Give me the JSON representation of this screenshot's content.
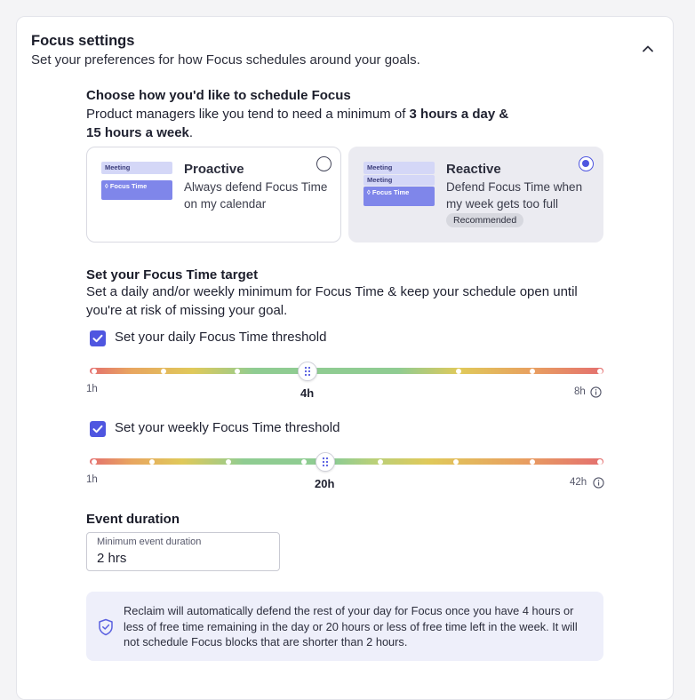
{
  "header": {
    "title": "Focus settings",
    "subtitle": "Set your preferences for how Focus schedules around your goals."
  },
  "schedule": {
    "title": "Choose how you'd like to schedule Focus",
    "body_prefix": "Product managers like you tend to need a minimum of ",
    "body_bold1": "3 hours a day &",
    "body_bold2": "15 hours a week",
    "body_suffix": ".",
    "options": [
      {
        "name": "Proactive",
        "description": "Always defend Focus Time on my calendar",
        "thumb_meeting": "Meeting",
        "thumb_focus": "Focus Time",
        "selected": false
      },
      {
        "name": "Reactive",
        "description": "Defend Focus Time when my week gets too full",
        "badge": "Recommended",
        "thumb_meeting": "Meeting",
        "thumb_meeting2": "Meeting",
        "thumb_focus": "Focus Time",
        "selected": true
      }
    ]
  },
  "target": {
    "title": "Set your Focus Time target",
    "body": "Set a daily and/or weekly minimum for Focus Time & keep your schedule open until you're at risk of missing your goal."
  },
  "daily": {
    "label": "Set your daily Focus Time threshold",
    "checked": true,
    "min_label": "1h",
    "max_label": "8h",
    "value_label": "4h",
    "min": 1,
    "max": 8,
    "value": 4
  },
  "weekly": {
    "label": "Set your weekly Focus Time threshold",
    "checked": true,
    "min_label": "1h",
    "max_label": "42h",
    "value_label": "20h",
    "min": 1,
    "max": 42,
    "value": 20
  },
  "duration": {
    "title": "Event duration",
    "field_label": "Minimum event duration",
    "field_value": "2 hrs"
  },
  "note": {
    "text": "Reclaim will automatically defend the rest of your day for Focus once you have 4 hours or less of free time remaining in the day or 20 hours or less of free time left in the week. It will not schedule Focus blocks that are shorter than 2 hours."
  },
  "colors": {
    "accent": "#4f56e0",
    "slider_low": "#e46f6f",
    "slider_mid": "#8fcc92",
    "slider_warm": "#e0c95a"
  }
}
